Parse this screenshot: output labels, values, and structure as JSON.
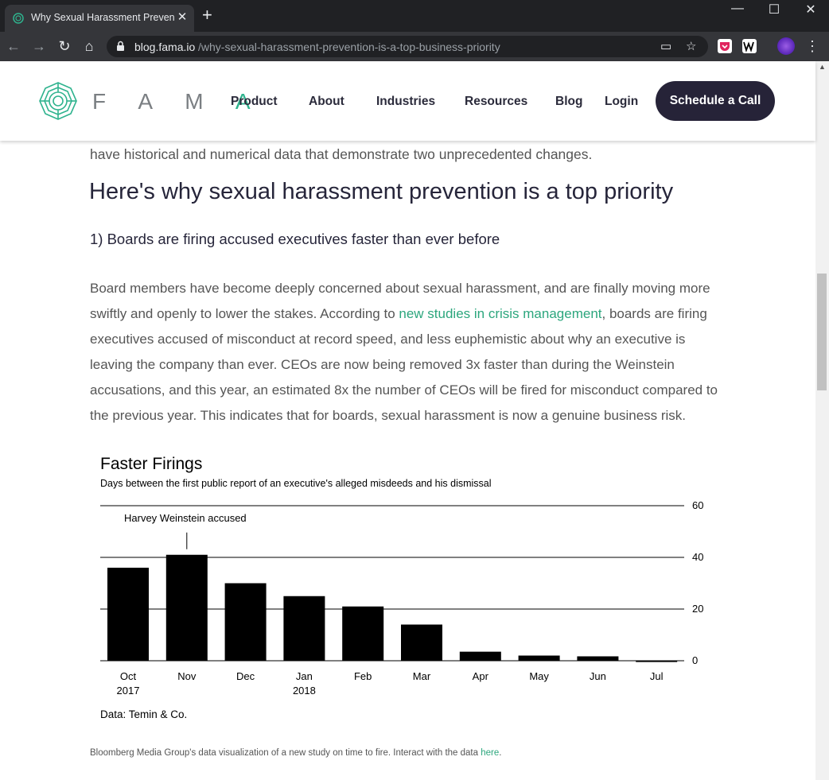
{
  "browser": {
    "tab_title": "Why Sexual Harassment Preventi",
    "url_host": "blog.fama.io",
    "url_path": "/why-sexual-harassment-prevention-is-a-top-business-priority"
  },
  "site": {
    "logo_text": "FAMA",
    "nav": [
      "Product",
      "About",
      "Industries",
      "Resources",
      "Blog",
      "Login"
    ],
    "cta": "Schedule a Call"
  },
  "article": {
    "cut_line": "have historical and numerical data that demonstrate two unprecedented changes.",
    "heading": "Here's why sexual harassment prevention is a top priority",
    "subheading": "1) Boards are firing accused executives faster than ever before",
    "para_before_link": "Board members have become deeply concerned about sexual harassment, and are finally moving more swiftly and openly to lower the stakes. According to ",
    "para_link": "new studies in crisis management",
    "para_after_link": ", boards are firing executives accused of misconduct at record speed, and less euphemistic about why an executive is leaving the company than ever. CEOs are now being removed 3x faster than during the Weinstein accusations, and this year, an estimated 8x the number of CEOs will be fired for misconduct compared to the previous year. This indicates that for boards, sexual harassment is now a genuine business risk.",
    "caption_text": "Bloomberg Media Group's data visualization of a new study on time to fire. Interact with the data ",
    "caption_link": "here",
    "caption_end": "."
  },
  "chart_data": {
    "type": "bar",
    "title": "Faster Firings",
    "subtitle": "Days between the first public report of an executive's alleged misdeeds and his dismissal",
    "categories": [
      "Oct",
      "Nov",
      "Dec",
      "Jan",
      "Feb",
      "Mar",
      "Apr",
      "May",
      "Jun",
      "Jul"
    ],
    "category_sublabels": [
      "2017",
      "",
      "",
      "2018",
      "",
      "",
      "",
      "",
      "",
      ""
    ],
    "values": [
      36,
      41,
      30,
      25,
      21,
      14,
      3.5,
      2,
      1.7,
      -0.5
    ],
    "ylim": [
      0,
      60
    ],
    "yticks": [
      0,
      20,
      40,
      60
    ],
    "y_axis_side": "right",
    "grid": true,
    "annotation": {
      "text": "Harvey Weinstein accused",
      "category": "Nov"
    },
    "source": "Data: Temin & Co.",
    "bar_color": "#000000"
  }
}
